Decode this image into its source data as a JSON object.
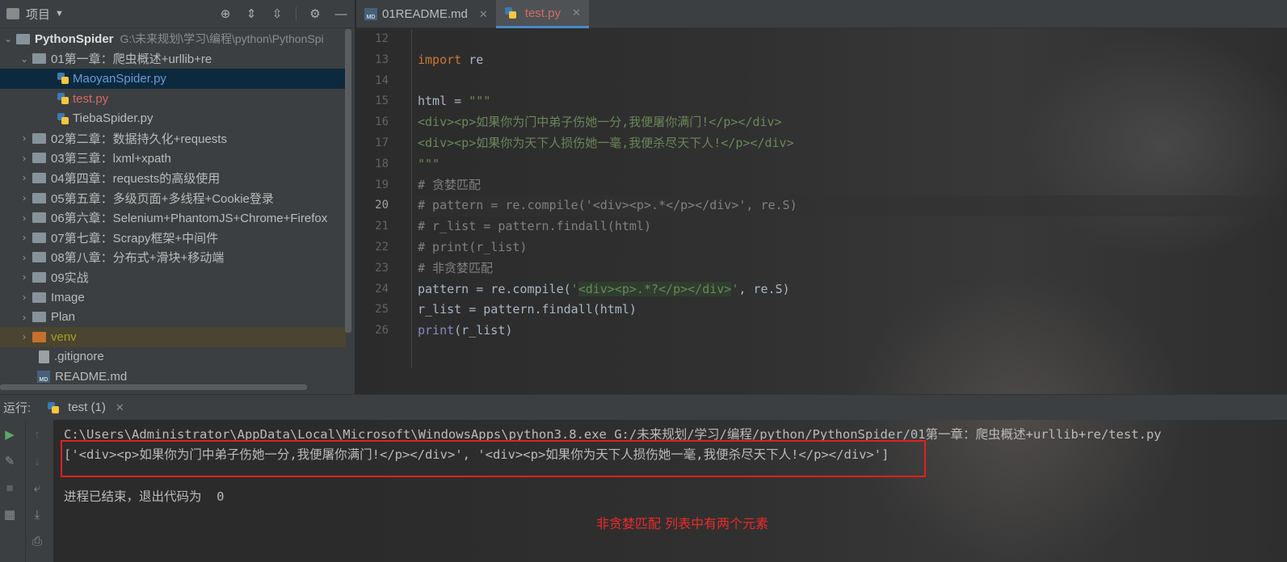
{
  "project_panel": {
    "title": "项目",
    "tree": [
      {
        "name": "PythonSpider",
        "path": "G:\\未来规划\\学习\\编程\\python\\PythonSpi",
        "type": "root"
      },
      {
        "name": "01第一章：爬虫概述+urllib+re",
        "type": "folder-open"
      },
      {
        "name": "MaoyanSpider.py",
        "type": "py",
        "selected": true
      },
      {
        "name": "test.py",
        "type": "py"
      },
      {
        "name": "TiebaSpider.py",
        "type": "py"
      },
      {
        "name": "02第二章：数据持久化+requests",
        "type": "folder"
      },
      {
        "name": "03第三章：lxml+xpath",
        "type": "folder"
      },
      {
        "name": "04第四章：requests的高级使用",
        "type": "folder"
      },
      {
        "name": "05第五章：多级页面+多线程+Cookie登录",
        "type": "folder"
      },
      {
        "name": "06第六章：Selenium+PhantomJS+Chrome+Firefox",
        "type": "folder"
      },
      {
        "name": "07第七章：Scrapy框架+中间件",
        "type": "folder"
      },
      {
        "name": "08第八章：分布式+滑块+移动端",
        "type": "folder"
      },
      {
        "name": "09实战",
        "type": "folder"
      },
      {
        "name": "Image",
        "type": "folder"
      },
      {
        "name": "Plan",
        "type": "folder"
      },
      {
        "name": "venv",
        "type": "folder-venv"
      },
      {
        "name": ".gitignore",
        "type": "file"
      },
      {
        "name": "README.md",
        "type": "md"
      }
    ]
  },
  "tabs": [
    {
      "label": "01README.md",
      "active": false
    },
    {
      "label": "test.py",
      "active": true
    }
  ],
  "editor": {
    "line_numbers": [
      "12",
      "13",
      "14",
      "15",
      "16",
      "17",
      "18",
      "19",
      "20",
      "21",
      "22",
      "23",
      "24",
      "25",
      "26"
    ],
    "current_line": "20",
    "lines": {
      "l13_kw": "import",
      "l13_rest": " re",
      "l15_a": "html = ",
      "l15_b": "\"\"\"",
      "l16": "<div><p>如果你为门中弟子伤她一分,我便屠你满门!</p></div>",
      "l17": "<div><p>如果你为天下人损伤她一毫,我便杀尽天下人!</p></div>",
      "l18": "\"\"\"",
      "l19": "# 贪婪匹配",
      "l20": "# pattern = re.compile('<div><p>.*</p></div>', re.S)",
      "l21": "# r_list = pattern.findall(html)",
      "l22": "# print(r_list)",
      "l23": "# 非贪婪匹配",
      "l24_a": "pattern = re.compile(",
      "l24_b": "'",
      "l24_c": "<div><p>.*?</p></div>",
      "l24_d": "'",
      "l24_e": ", re.S)",
      "l25": "r_list = pattern.findall(html)",
      "l26_fn": "print",
      "l26_rest": "(r_list)"
    }
  },
  "run": {
    "label": "运行:",
    "tab": "test (1)",
    "command": "C:\\Users\\Administrator\\AppData\\Local\\Microsoft\\WindowsApps\\python3.8.exe G:/未来规划/学习/编程/python/PythonSpider/01第一章：爬虫概述+urllib+re/test.py",
    "output": "['<div><p>如果你为门中弟子伤她一分,我便屠你满门!</p></div>', '<div><p>如果你为天下人损伤她一毫,我便杀尽天下人!</p></div>']",
    "exit": "进程已结束，退出代码为  0",
    "annotation": "非贪婪匹配 列表中有两个元素"
  },
  "colors": {
    "accent": "#4a88c7",
    "annotation_red": "#e02020"
  }
}
